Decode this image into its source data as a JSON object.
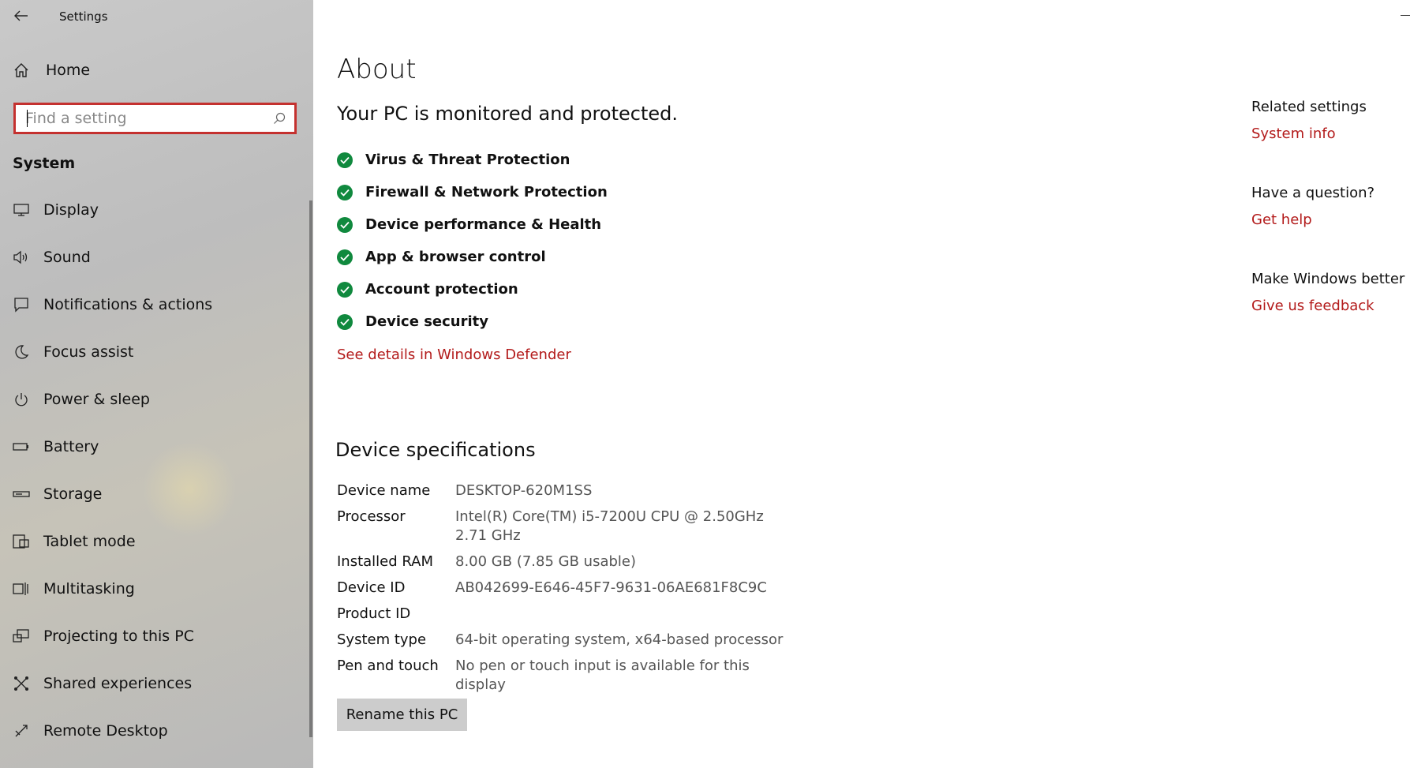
{
  "app": {
    "title": "Settings"
  },
  "sidebar": {
    "home_label": "Home",
    "search_placeholder": "Find a setting",
    "section_title": "System",
    "items": [
      {
        "label": "Display",
        "icon": "display-icon"
      },
      {
        "label": "Sound",
        "icon": "speaker-icon"
      },
      {
        "label": "Notifications & actions",
        "icon": "message-icon"
      },
      {
        "label": "Focus assist",
        "icon": "moon-icon"
      },
      {
        "label": "Power & sleep",
        "icon": "power-icon"
      },
      {
        "label": "Battery",
        "icon": "battery-icon"
      },
      {
        "label": "Storage",
        "icon": "storage-icon"
      },
      {
        "label": "Tablet mode",
        "icon": "tablet-icon"
      },
      {
        "label": "Multitasking",
        "icon": "multitasking-icon"
      },
      {
        "label": "Projecting to this PC",
        "icon": "projector-icon"
      },
      {
        "label": "Shared experiences",
        "icon": "shared-icon"
      },
      {
        "label": "Remote Desktop",
        "icon": "remote-desktop-icon"
      }
    ]
  },
  "main": {
    "title": "About",
    "protection": {
      "heading": "Your PC is monitored and protected.",
      "items": [
        "Virus & Threat Protection",
        "Firewall & Network Protection",
        "Device performance & Health",
        "App & browser control",
        "Account protection",
        "Device security"
      ],
      "status_color": "#10893e",
      "link": "See details in Windows Defender"
    },
    "specs": {
      "heading": "Device specifications",
      "rows": [
        {
          "key": "Device name",
          "value": "DESKTOP-620M1SS"
        },
        {
          "key": "Processor",
          "value": "Intel(R) Core(TM) i5-7200U CPU @ 2.50GHz   2.71 GHz"
        },
        {
          "key": "Installed RAM",
          "value": "8.00 GB (7.85 GB usable)"
        },
        {
          "key": "Device ID",
          "value": "AB042699-E646-45F7-9631-06AE681F8C9C"
        },
        {
          "key": "Product ID",
          "value": ""
        },
        {
          "key": "System type",
          "value": "64-bit operating system, x64-based processor"
        },
        {
          "key": "Pen and touch",
          "value": "No pen or touch input is available for this display"
        }
      ],
      "rename_button": "Rename this PC"
    }
  },
  "related": [
    {
      "heading": "Related settings",
      "link": "System info"
    },
    {
      "heading": "Have a question?",
      "link": "Get help"
    },
    {
      "heading": "Make Windows better",
      "link": "Give us feedback"
    }
  ],
  "colors": {
    "accent": "#b31b1b",
    "search_border": "#c4312f"
  }
}
